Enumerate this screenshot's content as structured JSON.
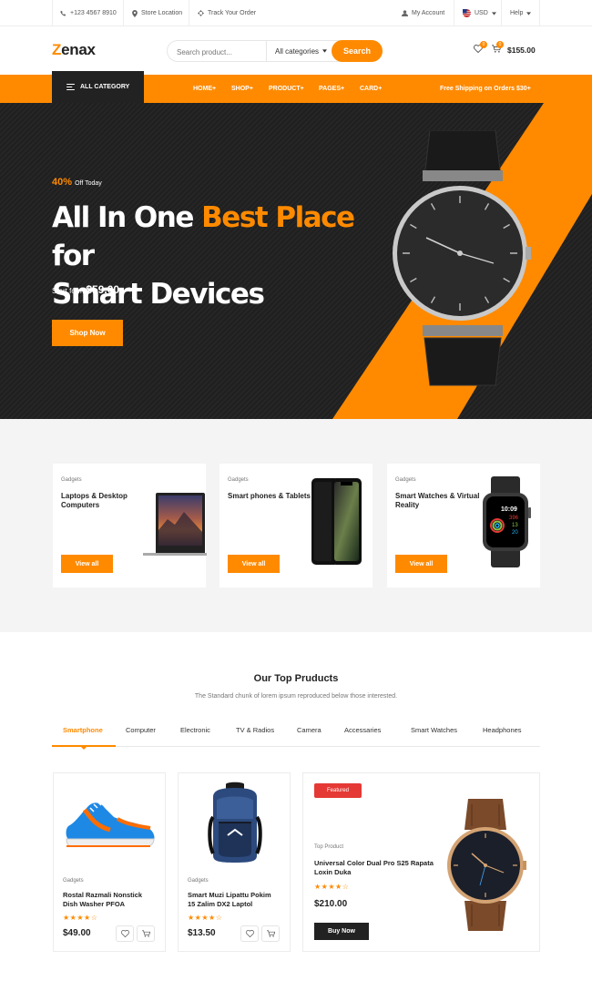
{
  "topbar": {
    "phone": "+123 4567 8910",
    "store": "Store Location",
    "track": "Track Your Order",
    "account": "My Account",
    "currency": "USD",
    "help": "Help"
  },
  "header": {
    "logo_first": "Z",
    "logo_rest": "enax",
    "search_placeholder": "Search product...",
    "search_category": "All categories",
    "search_button": "Search",
    "wishlist_count": "0",
    "cart_count": "0",
    "cart_total": "$155.00"
  },
  "nav": {
    "all_category": "ALL CATEGORY",
    "items": [
      "HOME+",
      "SHOP+",
      "PRODUCT+",
      "PAGES+",
      "CARD+"
    ],
    "shipping": "Free Shipping on Orders $30+"
  },
  "hero": {
    "offer_pct": "40%",
    "offer_text": "Off Today",
    "title_a": "All In One ",
    "title_highlight": "Best Place",
    "title_b": " for",
    "title_line2": "Smart Devices",
    "start_from": "Start form ",
    "price": "$59.00",
    "button": "Shop Now"
  },
  "categories": [
    {
      "small": "Gadgets",
      "title": "Laptops & Desktop Computers",
      "button": "View all"
    },
    {
      "small": "Gadgets",
      "title": "Smart phones & Tablets",
      "button": "View all"
    },
    {
      "small": "Gadgets",
      "title": "Smart Watches & Virtual Reality",
      "button": "View all"
    }
  ],
  "watch_screen": {
    "time": "10:09",
    "a": "396",
    "b": "13",
    "c": "20"
  },
  "products_section": {
    "title": "Our Top Pruducts",
    "subtitle": "The Standard chunk of lorem ipsum reproduced below those interested.",
    "tabs": [
      "Smartphone",
      "Computer",
      "Electronic",
      "TV & Radios",
      "Camera",
      "Accessaries",
      "Smart Watches",
      "Headphones"
    ]
  },
  "products": [
    {
      "category": "Gadgets",
      "name": "Rostal Razmali Nonstick Dish Washer PFOA",
      "rating": 4.5,
      "stars": "★★★★☆",
      "price": "$49.00"
    },
    {
      "category": "Gadgets",
      "name": "Smart Muzi Lipattu Pokim 15 Zalim DX2 Laptol",
      "rating": 3.5,
      "stars": "★★★★☆",
      "price": "$13.50"
    }
  ],
  "featured_product": {
    "badge": "Featured",
    "category": "Top Product",
    "name": "Universal Color Dual Pro S25 Rapata Loxin Duka",
    "rating": 4.5,
    "stars": "★★★★☆",
    "price": "$210.00",
    "button": "Buy Now"
  },
  "colors": {
    "accent": "#ff8a00",
    "dark": "#1f1f1f",
    "featured": "#e53935"
  }
}
